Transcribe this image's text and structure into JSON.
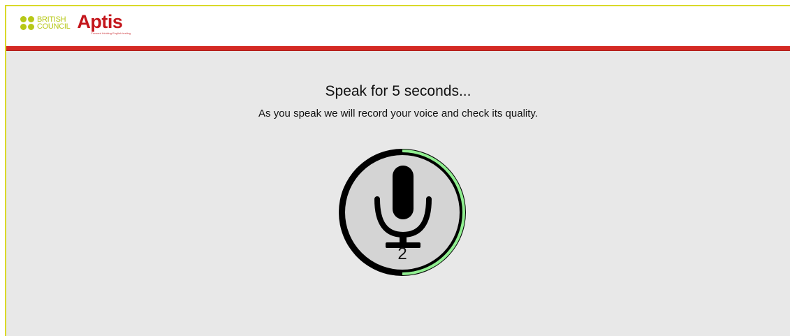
{
  "header": {
    "brand_line1": "BRITISH",
    "brand_line2": "COUNCIL",
    "product": "Aptis",
    "product_tagline": "Forward thinking English testing",
    "accent_color": "#d42a24",
    "brand_green": "#b7c817"
  },
  "main": {
    "title": "Speak for 5 seconds...",
    "subtitle": "As you speak we will record your voice and check its quality.",
    "recorder": {
      "icon": "microphone-icon",
      "countdown": "2",
      "progress": 0.5,
      "progress_color": "#90ee90"
    }
  }
}
